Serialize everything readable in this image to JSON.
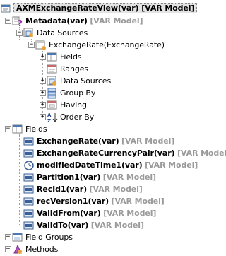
{
  "root": {
    "name": "AXMExchangeRateView(var)",
    "model": "[VAR Model]"
  },
  "metadata": {
    "name": "Metadata(var)",
    "model": "[VAR Model]"
  },
  "data_sources": {
    "label": "Data Sources"
  },
  "exchange_rate_ds": {
    "label": "ExchangeRate(ExchangeRate)"
  },
  "ds_children": [
    "Fields",
    "Ranges",
    "Data Sources",
    "Group By",
    "Having",
    "Order By"
  ],
  "fields_label": "Fields",
  "fields": [
    {
      "name": "ExchangeRate(var)",
      "model": "[VAR Model]"
    },
    {
      "name": "ExchangeRateCurrencyPair(var)",
      "model": "[VAR Model]"
    },
    {
      "name": "modifiedDateTime1(var)",
      "model": "[VAR Model]"
    },
    {
      "name": "Partition1(var)",
      "model": "[VAR Model]"
    },
    {
      "name": "RecId1(var)",
      "model": "[VAR Model]"
    },
    {
      "name": "recVersion1(var)",
      "model": "[VAR Model]"
    },
    {
      "name": "ValidFrom(var)",
      "model": "[VAR Model]"
    },
    {
      "name": "ValidTo(var)",
      "model": "[VAR Model]"
    }
  ],
  "field_groups_label": "Field Groups",
  "methods_label": "Methods"
}
